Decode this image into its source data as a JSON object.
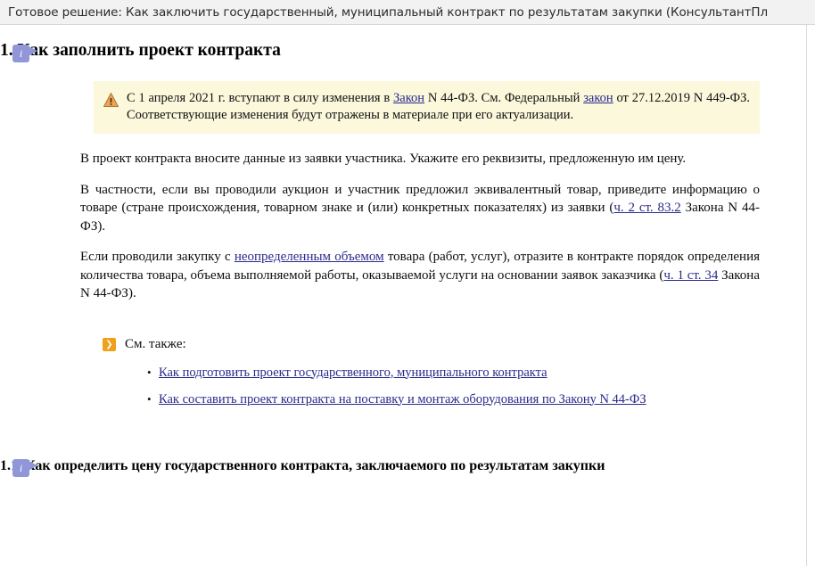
{
  "window": {
    "title": "Готовое решение: Как заключить государственный, муниципальный контракт по результатам закупки (КонсультантПл"
  },
  "colors": {
    "title_bar_bg": "#f2f2f2",
    "note_bg": "#fbf8dc",
    "info_marker": "#9096d8",
    "arrow_icon": "#f0a01a",
    "link": "#2a2a8c",
    "warn_icon": "#e09a3e"
  },
  "sections": [
    {
      "marker": "i",
      "heading": "1. Как заполнить проект контракта",
      "note": {
        "icon": "warning-triangle-icon",
        "text_before_link1": "С 1 апреля 2021 г. вступают в силу изменения в ",
        "link1": "Закон",
        "text_mid": " N 44-ФЗ. См. Федеральный ",
        "link2": "закон",
        "text_after": " от 27.12.2019 N 449-ФЗ. Соответствующие изменения будут отражены в материале при его актуализации."
      },
      "paragraphs": [
        {
          "segments": [
            {
              "type": "text",
              "value": "В проект контракта вносите данные из заявки участника. Укажите его реквизиты, предложенную им цену."
            }
          ]
        },
        {
          "segments": [
            {
              "type": "text",
              "value": "В частности, если вы проводили аукцион и участник предложил эквивалентный товар, приведите информацию о товаре (стране происхождения, товарном знаке и (или) конкретных показателях) из заявки ("
            },
            {
              "type": "link",
              "value": "ч. 2 ст. 83.2"
            },
            {
              "type": "text",
              "value": " Закона N 44-ФЗ)."
            }
          ]
        },
        {
          "segments": [
            {
              "type": "text",
              "value": "Если проводили закупку с "
            },
            {
              "type": "link",
              "value": "неопределенным объемом"
            },
            {
              "type": "text",
              "value": " товара (работ, услуг), отразите в контракте порядок определения количества товара, объема выполняемой работы, оказываемой услуги на основании заявок заказчика ("
            },
            {
              "type": "link",
              "value": "ч. 1 ст. 34"
            },
            {
              "type": "text",
              "value": " Закона N 44-ФЗ)."
            }
          ]
        }
      ],
      "see_also": {
        "icon": "chevron-right-icon",
        "label": "См. также:",
        "items": [
          "Как подготовить проект государственного, муниципального контракта",
          "Как составить проект контракта на поставку и монтаж оборудования по Закону N 44-ФЗ"
        ]
      }
    },
    {
      "marker": "i",
      "heading": "1.1. Как определить цену государственного контракта, заключаемого по результатам закупки"
    }
  ]
}
